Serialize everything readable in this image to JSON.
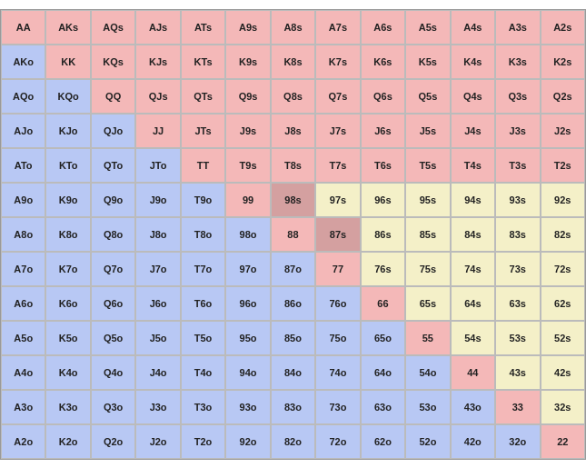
{
  "grid": {
    "cells": [
      [
        "AA",
        "AKs",
        "AQs",
        "AJs",
        "ATs",
        "A9s",
        "A8s",
        "A7s",
        "A6s",
        "A5s",
        "A4s",
        "A3s",
        "A2s"
      ],
      [
        "AKo",
        "KK",
        "KQs",
        "KJs",
        "KTs",
        "K9s",
        "K8s",
        "K7s",
        "K6s",
        "K5s",
        "K4s",
        "K3s",
        "K2s"
      ],
      [
        "AQo",
        "KQo",
        "QQ",
        "QJs",
        "QTs",
        "Q9s",
        "Q8s",
        "Q7s",
        "Q6s",
        "Q5s",
        "Q4s",
        "Q3s",
        "Q2s"
      ],
      [
        "AJo",
        "KJo",
        "QJo",
        "JJ",
        "JTs",
        "J9s",
        "J8s",
        "J7s",
        "J6s",
        "J5s",
        "J4s",
        "J3s",
        "J2s"
      ],
      [
        "ATo",
        "KTo",
        "QTo",
        "JTo",
        "TT",
        "T9s",
        "T8s",
        "T7s",
        "T6s",
        "T5s",
        "T4s",
        "T3s",
        "T2s"
      ],
      [
        "A9o",
        "K9o",
        "Q9o",
        "J9o",
        "T9o",
        "99",
        "98s",
        "97s",
        "96s",
        "95s",
        "94s",
        "93s",
        "92s"
      ],
      [
        "A8o",
        "K8o",
        "Q8o",
        "J8o",
        "T8o",
        "98o",
        "88",
        "87s",
        "86s",
        "85s",
        "84s",
        "83s",
        "82s"
      ],
      [
        "A7o",
        "K7o",
        "Q7o",
        "J7o",
        "T7o",
        "97o",
        "87o",
        "77",
        "76s",
        "75s",
        "74s",
        "73s",
        "72s"
      ],
      [
        "A6o",
        "K6o",
        "Q6o",
        "J6o",
        "T6o",
        "96o",
        "86o",
        "76o",
        "66",
        "65s",
        "64s",
        "63s",
        "62s"
      ],
      [
        "A5o",
        "K5o",
        "Q5o",
        "J5o",
        "T5o",
        "95o",
        "85o",
        "75o",
        "65o",
        "55",
        "54s",
        "53s",
        "52s"
      ],
      [
        "A4o",
        "K4o",
        "Q4o",
        "J4o",
        "T4o",
        "94o",
        "84o",
        "74o",
        "64o",
        "54o",
        "44",
        "43s",
        "42s"
      ],
      [
        "A3o",
        "K3o",
        "Q3o",
        "J3o",
        "T3o",
        "93o",
        "83o",
        "73o",
        "63o",
        "53o",
        "43o",
        "33",
        "32s"
      ],
      [
        "A2o",
        "K2o",
        "Q2o",
        "J2o",
        "T2o",
        "92o",
        "82o",
        "72o",
        "62o",
        "52o",
        "42o",
        "32o",
        "22"
      ]
    ],
    "colors": [
      [
        "pink",
        "pink",
        "pink",
        "pink",
        "pink",
        "pink",
        "pink",
        "pink",
        "pink",
        "pink",
        "pink",
        "pink",
        "pink"
      ],
      [
        "blue",
        "pink",
        "pink",
        "pink",
        "pink",
        "pink",
        "pink",
        "pink",
        "pink",
        "pink",
        "pink",
        "pink",
        "pink"
      ],
      [
        "blue",
        "blue",
        "pink",
        "pink",
        "pink",
        "pink",
        "pink",
        "pink",
        "pink",
        "pink",
        "pink",
        "pink",
        "pink"
      ],
      [
        "blue",
        "blue",
        "blue",
        "pink",
        "pink",
        "pink",
        "pink",
        "pink",
        "pink",
        "pink",
        "pink",
        "pink",
        "pink"
      ],
      [
        "blue",
        "blue",
        "blue",
        "blue",
        "pink",
        "pink",
        "pink",
        "pink",
        "pink",
        "pink",
        "pink",
        "pink",
        "pink"
      ],
      [
        "blue",
        "blue",
        "blue",
        "blue",
        "blue",
        "pink",
        "pink",
        "yellow",
        "yellow",
        "yellow",
        "yellow",
        "yellow",
        "yellow"
      ],
      [
        "blue",
        "blue",
        "blue",
        "blue",
        "blue",
        "blue",
        "pink",
        "pink",
        "yellow",
        "yellow",
        "yellow",
        "yellow",
        "yellow"
      ],
      [
        "blue",
        "blue",
        "blue",
        "blue",
        "blue",
        "blue",
        "blue",
        "pink",
        "yellow",
        "yellow",
        "yellow",
        "yellow",
        "yellow"
      ],
      [
        "blue",
        "blue",
        "blue",
        "blue",
        "blue",
        "blue",
        "blue",
        "blue",
        "pink",
        "yellow",
        "yellow",
        "yellow",
        "yellow"
      ],
      [
        "blue",
        "blue",
        "blue",
        "blue",
        "blue",
        "blue",
        "blue",
        "blue",
        "blue",
        "pink",
        "yellow",
        "yellow",
        "yellow"
      ],
      [
        "blue",
        "blue",
        "blue",
        "blue",
        "blue",
        "blue",
        "blue",
        "blue",
        "blue",
        "blue",
        "pink",
        "yellow",
        "yellow"
      ],
      [
        "blue",
        "blue",
        "blue",
        "blue",
        "blue",
        "blue",
        "blue",
        "blue",
        "blue",
        "blue",
        "blue",
        "pink",
        "yellow"
      ],
      [
        "blue",
        "blue",
        "blue",
        "blue",
        "blue",
        "blue",
        "blue",
        "blue",
        "blue",
        "blue",
        "blue",
        "blue",
        "pink"
      ]
    ]
  }
}
